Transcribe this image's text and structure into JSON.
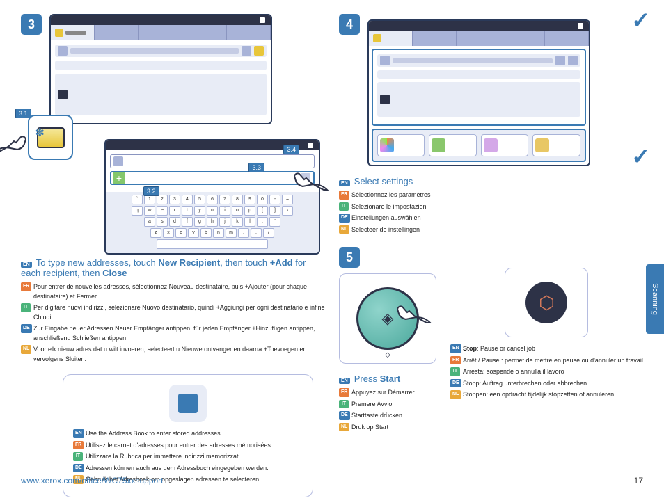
{
  "steps": {
    "s3": "3",
    "s4": "4",
    "s5": "5"
  },
  "callouts": {
    "c31": "3.1",
    "c32": "3.2",
    "c33": "3.3",
    "c34": "3.4"
  },
  "step3": {
    "heading_en": "To type new addresses, touch New Recipient, then touch +Add for each recipient, then Close",
    "fr": "Pour entrer de nouvelles adresses, sélectionnez Nouveau destinataire, puis +Ajouter (pour chaque destinataire) et Fermer",
    "it": "Per digitare nuovi indirizzi, selezionare Nuovo destinatario, quindi +Aggiungi per ogni destinatario e infine Chiudi",
    "de": "Zur Eingabe neuer Adressen Neuer Empfänger antippen, für jeden Empfänger +Hinzufügen antippen, anschließend Schließen antippen",
    "nl": "Voor elk nieuw adres dat u wilt invoeren, selecteert u Nieuwe ontvanger en daarna +Toevoegen en vervolgens Sluiten."
  },
  "info": {
    "en": "Use the Address Book to enter stored addresses.",
    "fr": "Utilisez le carnet d'adresses pour entrer des adresses mémorisées.",
    "it": "Utilizzare la Rubrica per immettere indirizzi memorizzati.",
    "de": "Adressen können auch aus dem Adressbuch eingegeben werden.",
    "nl": "Gebruik het Adresboek om opgeslagen adressen te selecteren."
  },
  "step4": {
    "heading_en": "Select settings",
    "fr": "Sélectionnez les paramètres",
    "it": "Selezionare le impostazioni",
    "de": "Einstellungen auswählen",
    "nl": "Selecteer de instellingen"
  },
  "step5": {
    "heading_en": "Press Start",
    "fr": "Appuyez sur Démarrer",
    "it": "Premere Avvio",
    "de": "Starttaste drücken",
    "nl": "Druk op Start"
  },
  "stop": {
    "en": "Stop: Pause or cancel job",
    "fr": "Arrêt / Pause : permet de mettre en pause ou d'annuler un travail",
    "it": "Arresta: sospende o annulla il lavoro",
    "de": "Stopp: Auftrag unterbrechen oder abbrechen",
    "nl": "Stoppen: een opdracht tijdelijk stopzetten of annuleren"
  },
  "kb": {
    "row1": [
      "`",
      "1",
      "2",
      "3",
      "4",
      "5",
      "6",
      "7",
      "8",
      "9",
      "0",
      "-",
      "="
    ],
    "row2": [
      "q",
      "w",
      "e",
      "r",
      "t",
      "y",
      "u",
      "i",
      "o",
      "p",
      "[",
      "]",
      "\\"
    ],
    "row3": [
      "a",
      "s",
      "d",
      "f",
      "g",
      "h",
      "j",
      "k",
      "l",
      ";",
      "'"
    ],
    "row4": [
      "z",
      "x",
      "c",
      "v",
      "b",
      "n",
      "m",
      ",",
      ".",
      "/"
    ]
  },
  "sidetab": "Scanning",
  "footer": {
    "url": "www.xerox.com/office/WC75xxsupport",
    "page": "17"
  },
  "tags": {
    "en": "EN",
    "fr": "FR",
    "it": "IT",
    "de": "DE",
    "nl": "NL"
  }
}
